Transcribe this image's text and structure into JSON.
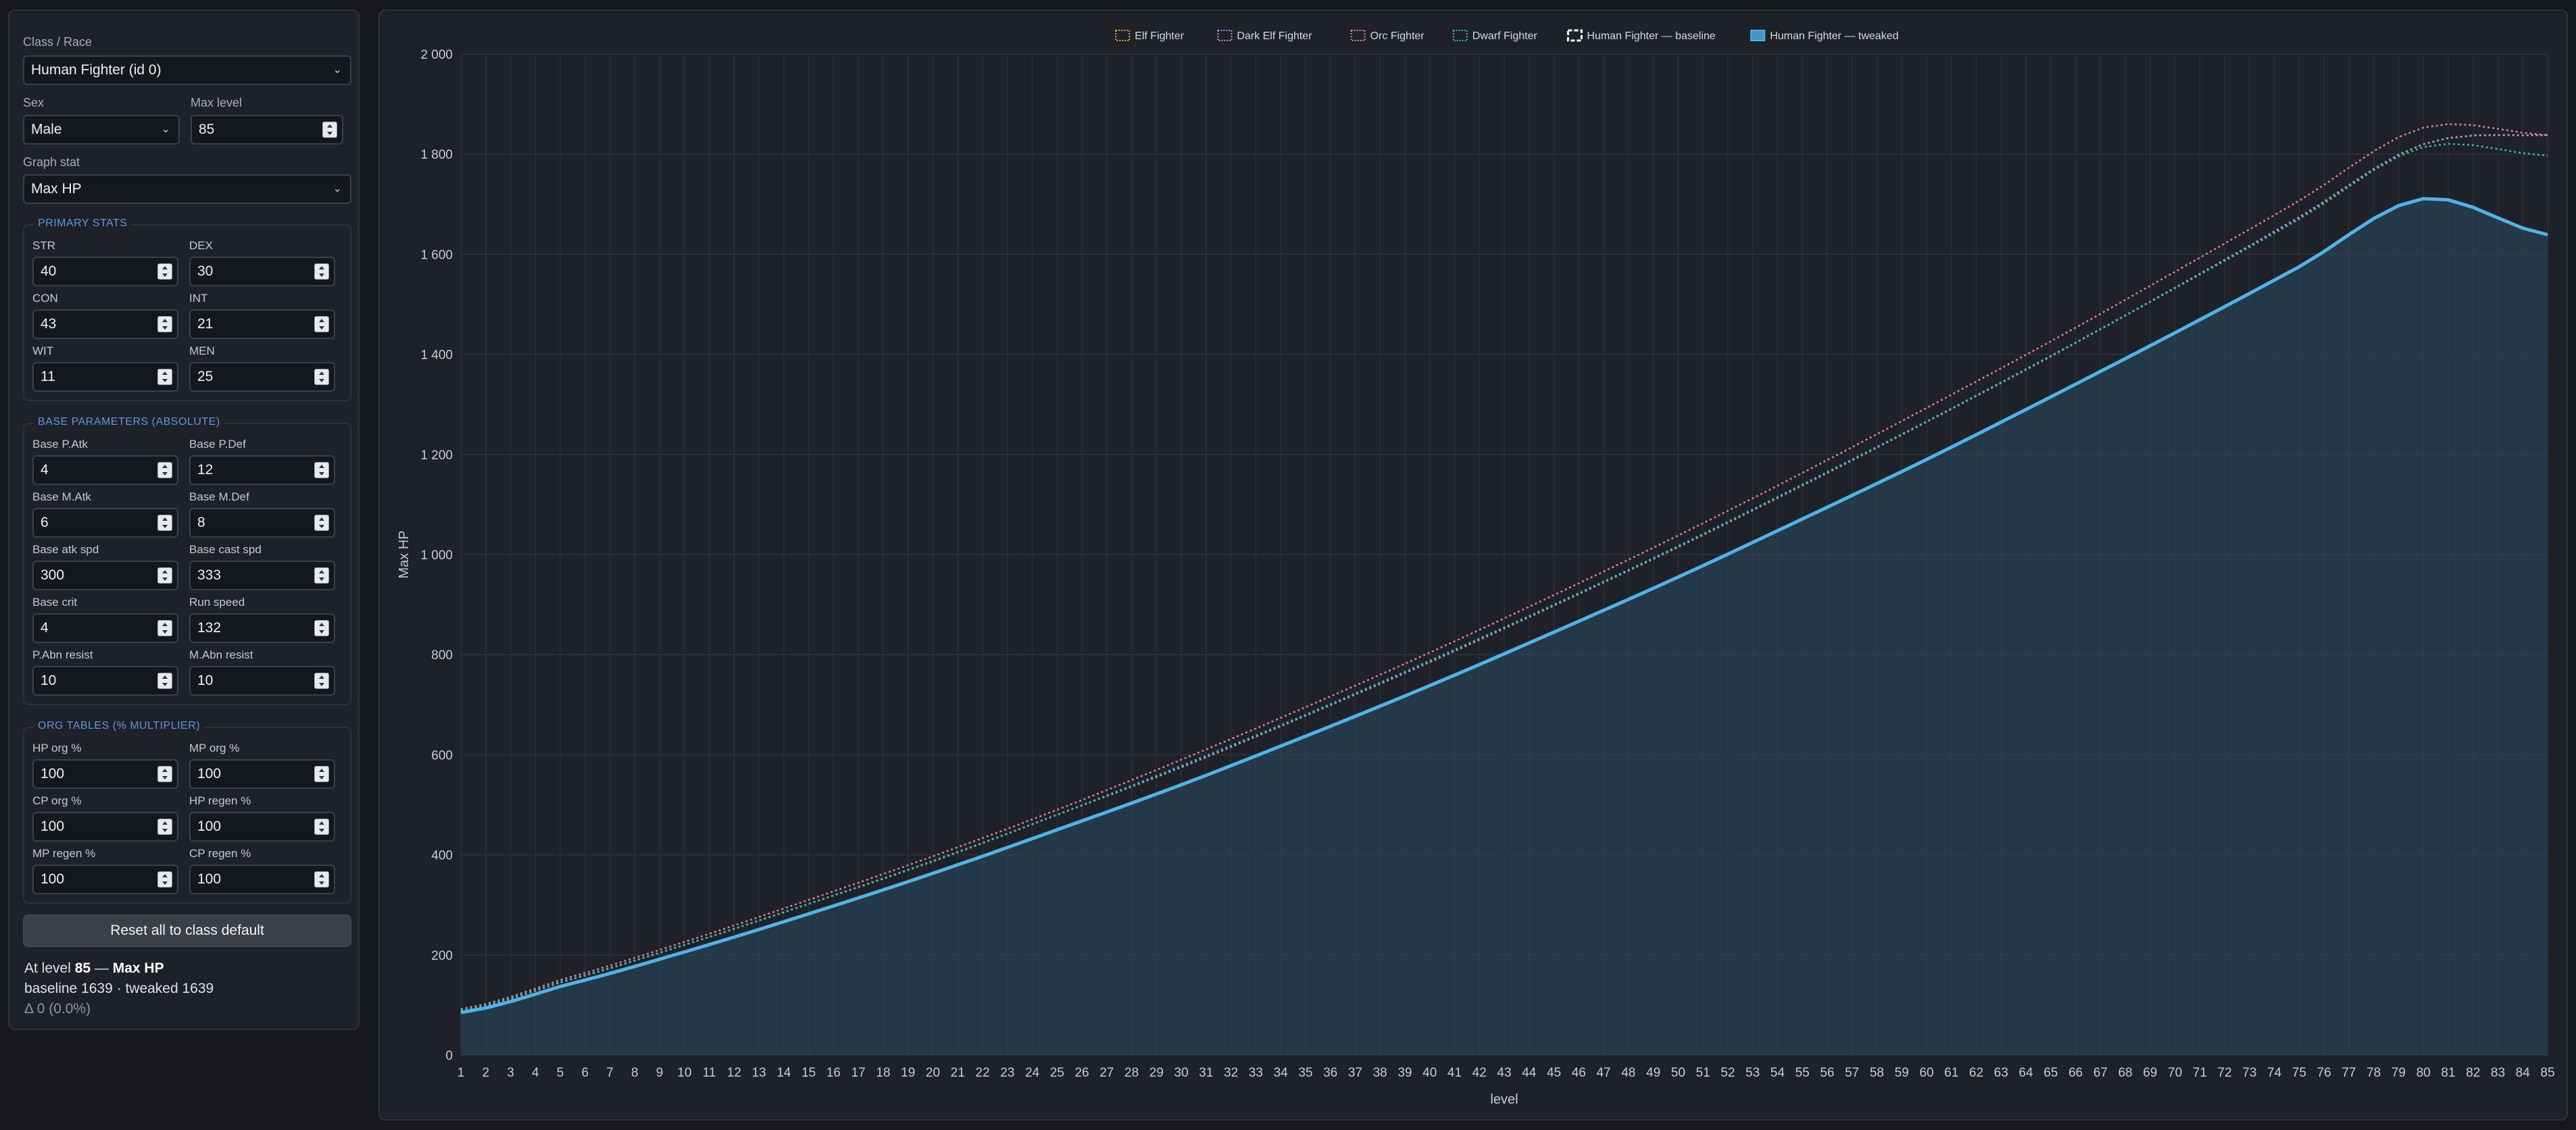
{
  "controls": {
    "class_race_label": "Class / Race",
    "class_race_value": "Human Fighter (id 0)",
    "sex_label": "Sex",
    "sex_value": "Male",
    "max_level_label": "Max level",
    "max_level_value": "85",
    "graph_stat_label": "Graph stat",
    "graph_stat_value": "Max HP"
  },
  "primary_stats": {
    "title": "PRIMARY STATS",
    "fields": [
      {
        "label": "STR",
        "value": "40"
      },
      {
        "label": "DEX",
        "value": "30"
      },
      {
        "label": "CON",
        "value": "43"
      },
      {
        "label": "INT",
        "value": "21"
      },
      {
        "label": "WIT",
        "value": "11"
      },
      {
        "label": "MEN",
        "value": "25"
      }
    ]
  },
  "base_params": {
    "title": "BASE PARAMETERS (ABSOLUTE)",
    "fields": [
      {
        "label": "Base P.Atk",
        "value": "4"
      },
      {
        "label": "Base P.Def",
        "value": "12"
      },
      {
        "label": "Base M.Atk",
        "value": "6"
      },
      {
        "label": "Base M.Def",
        "value": "8"
      },
      {
        "label": "Base atk spd",
        "value": "300"
      },
      {
        "label": "Base cast spd",
        "value": "333"
      },
      {
        "label": "Base crit",
        "value": "4"
      },
      {
        "label": "Run speed",
        "value": "132"
      },
      {
        "label": "P.Abn resist",
        "value": "10"
      },
      {
        "label": "M.Abn resist",
        "value": "10"
      }
    ]
  },
  "org_tables": {
    "title": "ORG TABLES (% MULTIPLIER)",
    "fields": [
      {
        "label": "HP org %",
        "value": "100"
      },
      {
        "label": "MP org %",
        "value": "100"
      },
      {
        "label": "CP org %",
        "value": "100"
      },
      {
        "label": "HP regen %",
        "value": "100"
      },
      {
        "label": "MP regen %",
        "value": "100"
      },
      {
        "label": "CP regen %",
        "value": "100"
      }
    ]
  },
  "reset_label": "Reset all to class default",
  "summary": {
    "prefix": "At level ",
    "level": "85",
    "sep": " — ",
    "stat": "Max HP",
    "line2": "baseline 1639 · tweaked 1639",
    "line3": "Δ 0 (0.0%)"
  },
  "chart_data": {
    "type": "line",
    "xlabel": "level",
    "ylabel": "Max HP",
    "xlim": [
      1,
      85
    ],
    "ylim": [
      0,
      2000
    ],
    "yticks": [
      0,
      200,
      400,
      600,
      800,
      1000,
      1200,
      1400,
      1600,
      1800,
      2000
    ],
    "ytick_labels": [
      "0",
      "200",
      "400",
      "600",
      "800",
      "1 000",
      "1 200",
      "1 400",
      "1 600",
      "1 800",
      "2 000"
    ],
    "legend_position": "top",
    "x": [
      1,
      5,
      10,
      15,
      20,
      25,
      30,
      35,
      40,
      45,
      50,
      55,
      60,
      65,
      70,
      75,
      80,
      85
    ],
    "series": [
      {
        "name": "Elf Fighter",
        "style": "dotted",
        "color": "#e8a24a",
        "values": [
          89,
          145,
          220,
          302,
          387,
          480,
          575,
          678,
          785,
          898,
          1015,
          1138,
          1265,
          1396,
          1533,
          1674,
          1820,
          1838
        ]
      },
      {
        "name": "Dark Elf Fighter",
        "style": "dotted",
        "color": "#b48fe0",
        "values": [
          89,
          145,
          220,
          302,
          387,
          480,
          575,
          678,
          785,
          898,
          1015,
          1138,
          1265,
          1396,
          1533,
          1674,
          1820,
          1838
        ]
      },
      {
        "name": "Orc Fighter",
        "style": "dotted",
        "color": "#e57f8f",
        "values": [
          92,
          150,
          226,
          310,
          397,
          490,
          590,
          695,
          804,
          919,
          1038,
          1163,
          1293,
          1426,
          1565,
          1707,
          1853,
          1838
        ]
      },
      {
        "name": "Dwarf Fighter",
        "style": "dotted",
        "color": "#33b8a8",
        "values": [
          90,
          146,
          220,
          302,
          388,
          480,
          578,
          680,
          788,
          900,
          1017,
          1140,
          1266,
          1397,
          1532,
          1670,
          1814,
          1797
        ]
      },
      {
        "name": "Human Fighter — baseline",
        "style": "dashed",
        "color": "#ffffff",
        "values": [
          85,
          137,
          206,
          282,
          363,
          450,
          540,
          637,
          738,
          845,
          955,
          1071,
          1190,
          1315,
          1443,
          1575,
          1711,
          1639
        ]
      },
      {
        "name": "Human Fighter — tweaked",
        "style": "area",
        "color": "#4fb3ea",
        "values": [
          85,
          137,
          206,
          282,
          363,
          450,
          540,
          637,
          738,
          845,
          955,
          1071,
          1190,
          1315,
          1443,
          1575,
          1711,
          1639
        ]
      }
    ]
  }
}
